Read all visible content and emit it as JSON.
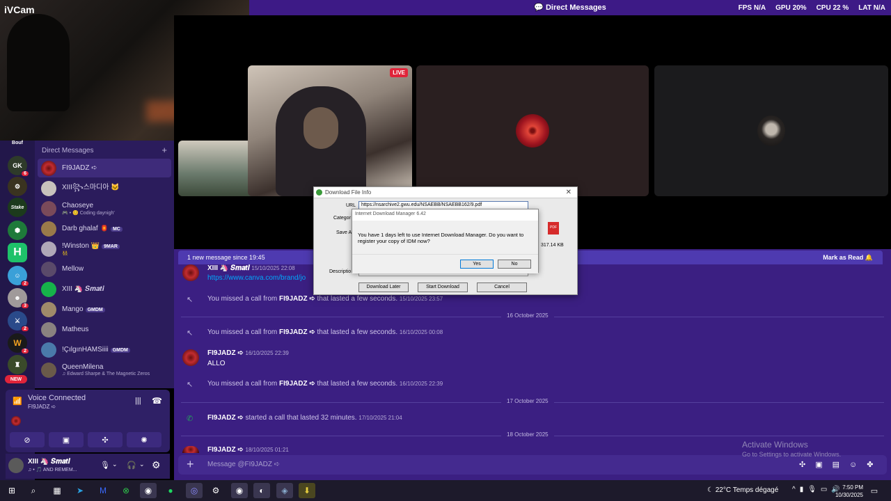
{
  "webcam": {
    "label": "iVCam"
  },
  "topbar": {
    "title": "Direct Messages",
    "stats": [
      {
        "name": "FPS",
        "value": "N/A"
      },
      {
        "name": "GPU",
        "value": "20%"
      },
      {
        "name": "CPU",
        "value": "22 %"
      },
      {
        "name": "LAT",
        "value": "N/A"
      }
    ]
  },
  "stream": {
    "live_label": "LIVE"
  },
  "servers": [
    {
      "label": "Bouf",
      "badge": ""
    },
    {
      "label": "GK",
      "badge": "6"
    },
    {
      "label": "⚙",
      "badge": ""
    },
    {
      "label": "Stake",
      "badge": ""
    },
    {
      "label": "⬢",
      "badge": ""
    },
    {
      "label": "H",
      "badge": ""
    },
    {
      "label": "☺",
      "badge": "2"
    },
    {
      "label": "☻",
      "badge": "3"
    },
    {
      "label": "⚔",
      "badge": "2"
    },
    {
      "label": "W",
      "badge": "2"
    },
    {
      "label": "♜",
      "badge": ""
    },
    {
      "label": "NEW",
      "badge": ""
    }
  ],
  "dms": {
    "header": "Direct Messages",
    "items": [
      {
        "name": "FI9JADZ ➪",
        "sub": ""
      },
      {
        "name": "XIII꧂스마디아 🐱",
        "sub": ""
      },
      {
        "name": "Chaoseye",
        "sub": "🎮 • 😊 Coding daynigh'"
      },
      {
        "name": "Darb ghalaf 🏮",
        "sub": "",
        "tag": "MC"
      },
      {
        "name": "!Winston 👑",
        "sub": "👯",
        "tag": "9MAR"
      },
      {
        "name": "Mellow",
        "sub": ""
      },
      {
        "name": "XIII 🦄 𝑺𝒎𝒂𝒕𝒊",
        "sub": ""
      },
      {
        "name": "Mango",
        "sub": "",
        "tag": "GMDM"
      },
      {
        "name": "Matheus",
        "sub": ""
      },
      {
        "name": "!ÇılgınHAMSiiii",
        "sub": "",
        "tag": "GMDM"
      },
      {
        "name": "QueenMilena",
        "sub": "♫ Edward Sharpe & The Magnetic Zeros"
      }
    ]
  },
  "voice": {
    "status": "Voice Connected",
    "channel": "FI9JADZ ➪"
  },
  "user": {
    "name": "XIII 🦄 𝑺𝒎𝒂𝒕𝒊",
    "status": "♫ • 🎵 AND REMEM..."
  },
  "chat": {
    "banner_left": "1 new message since 19:45",
    "banner_right": "Mark as Read",
    "messages": [
      {
        "kind": "msg",
        "author": "XIII 🦄 𝑺𝒎𝒂𝒕𝒊",
        "time": "15/10/2025 22:08",
        "text": "https://www.canva.com/brand/jo"
      },
      {
        "kind": "call",
        "pre": "You missed a call from",
        "who": "FI9JADZ ➪",
        "post": "that lasted a few seconds.",
        "time": "15/10/2025 23:57"
      },
      {
        "kind": "date",
        "text": "16 October 2025"
      },
      {
        "kind": "call",
        "pre": "You missed a call from",
        "who": "FI9JADZ ➪",
        "post": "that lasted a few seconds.",
        "time": "16/10/2025 00:08"
      },
      {
        "kind": "msg",
        "author": "FI9JADZ ➪",
        "time": "16/10/2025 22:39",
        "text": "ALLO"
      },
      {
        "kind": "call",
        "pre": "You missed a call from",
        "who": "FI9JADZ ➪",
        "post": "that lasted a few seconds.",
        "time": "16/10/2025 22:39"
      },
      {
        "kind": "date",
        "text": "17 October 2025"
      },
      {
        "kind": "call",
        "pre": "",
        "who": "FI9JADZ ➪",
        "post": "started a call that lasted 32 minutes.",
        "time": "17/10/2025 21:04"
      },
      {
        "kind": "date",
        "text": "18 October 2025"
      },
      {
        "kind": "msg",
        "author": "FI9JADZ ➪",
        "time": "18/10/2025 01:21",
        "text": ""
      }
    ],
    "composer_placeholder": "Message @FI9JADZ ➪"
  },
  "activate": {
    "line1": "Activate Windows",
    "line2": "Go to Settings to activate Windows."
  },
  "idm": {
    "title": "Download File Info",
    "url_label": "URL",
    "url": "https://nsarchive2.gwu.edu/NSAEBB/NSAEBB162/9.pdf",
    "category_label": "Categor",
    "save_label": "Save A",
    "desc_label": "Descriptio",
    "size": "317.14 KB",
    "file_icon": "PDF",
    "buttons": [
      "Download Later",
      "Start Download",
      "Cancel"
    ],
    "nag": {
      "title": "Internet Download Manager 6.42",
      "message": "You have 1 days left to use Internet Download Manager. Do you want to register your copy of IDM now?",
      "yes": "Yes",
      "no": "No"
    }
  },
  "taskbar": {
    "weather": "22°C  Temps dégagé",
    "time": "7:50 PM",
    "date": "10/30/2025"
  }
}
